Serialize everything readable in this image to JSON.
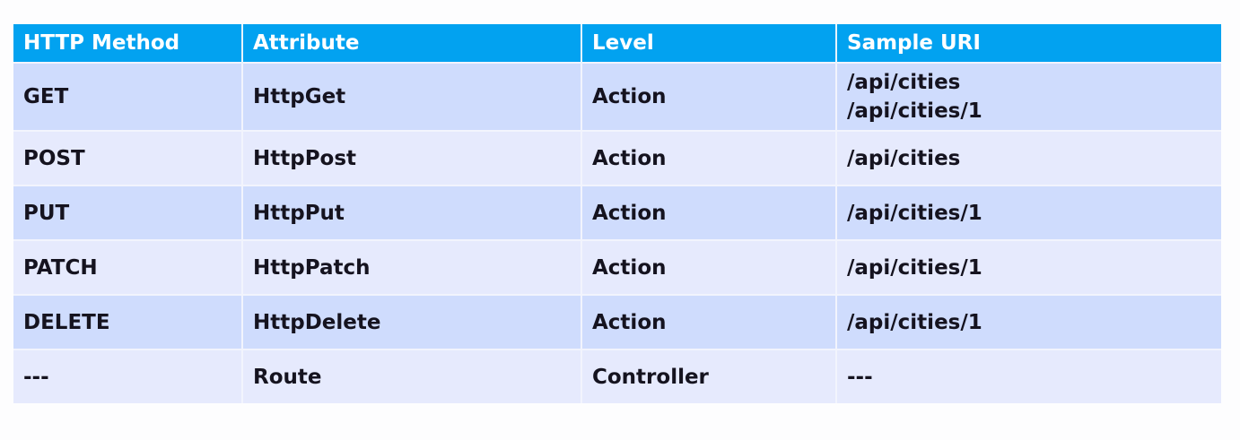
{
  "headers": [
    "HTTP Method",
    "Attribute",
    "Level",
    "Sample URI"
  ],
  "rows": [
    [
      "GET",
      "HttpGet",
      "Action",
      "/api/cities",
      "/api/cities/1"
    ],
    [
      "POST",
      "HttpPost",
      "Action",
      "/api/cities"
    ],
    [
      "PUT",
      "HttpPut",
      "Action",
      "/api/cities/1"
    ],
    [
      "PATCH",
      "HttpPatch",
      "Action",
      "/api/cities/1"
    ],
    [
      "DELETE",
      "HttpDelete",
      "Action",
      "/api/cities/1"
    ],
    [
      "---",
      "Route",
      "Controller",
      "---"
    ]
  ],
  "colors": {
    "header": "#02a2f0",
    "row_odd": "#cfdcfd",
    "row_even": "#e6eafd"
  }
}
